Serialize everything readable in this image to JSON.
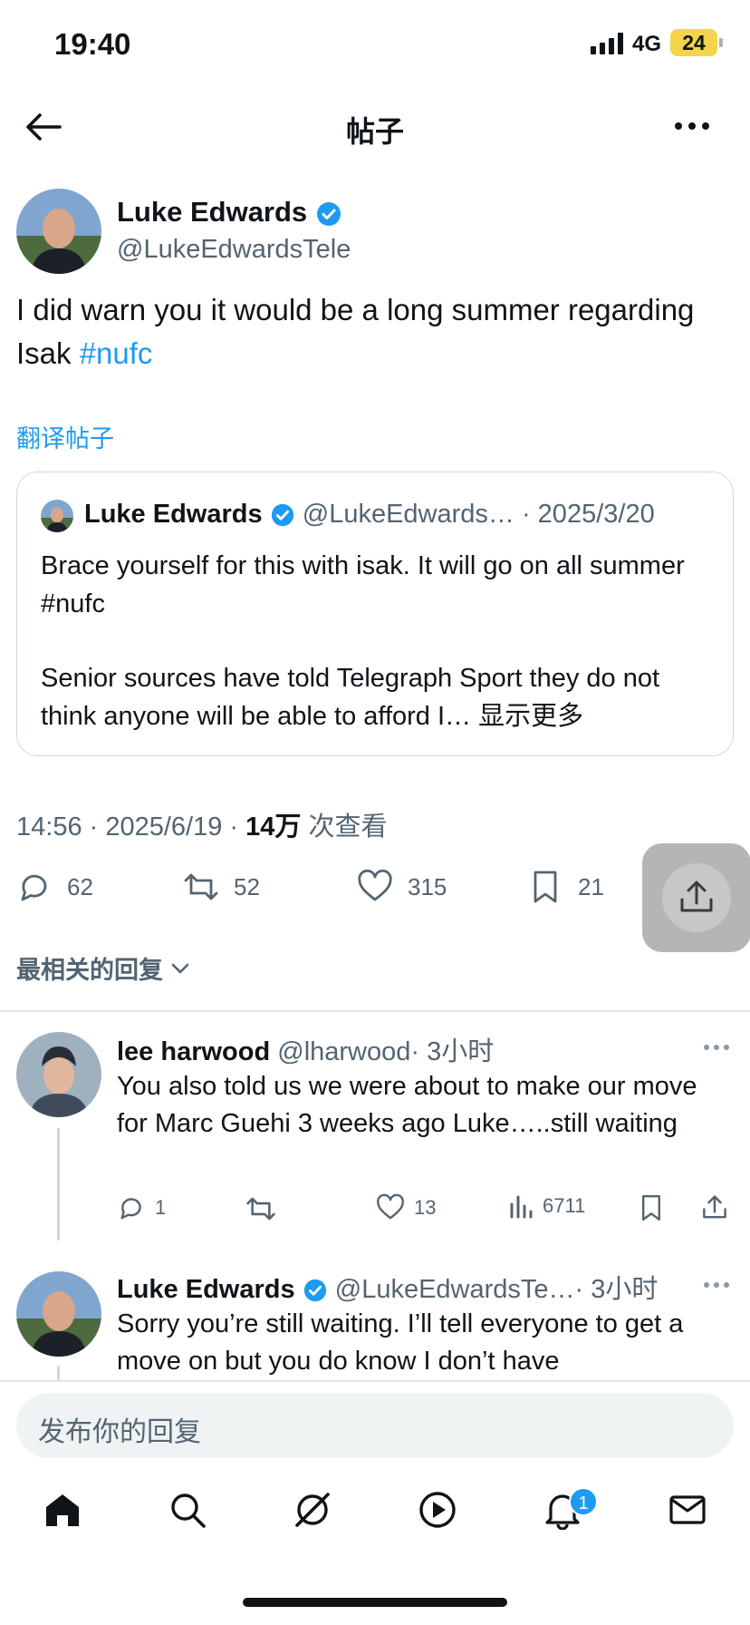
{
  "status_bar": {
    "time": "19:40",
    "network": "4G",
    "battery": "24"
  },
  "header": {
    "title": "帖子"
  },
  "post": {
    "author_name": "Luke Edwards",
    "author_handle": "@LukeEdwardsTele",
    "text_main": "I did warn you it would be a long summer regarding Isak ",
    "hashtag": "#nufc",
    "translate_label": "翻译帖子",
    "quoted": {
      "name": "Luke Edwards",
      "handle": "@LukeEdwards…",
      "date": "· 2025/3/20",
      "text_p1": "Brace yourself for this with isak. It will go on all summer #nufc",
      "text_p2": "Senior sources have told Telegraph Sport they do not think anyone will be able to afford I… 显示更多"
    },
    "meta_time": "14:56 · 2025/6/19 · ",
    "meta_views": "14万",
    "meta_views_label": " 次查看",
    "stats": {
      "replies": "62",
      "reposts": "52",
      "likes": "315",
      "bookmarks": "21"
    }
  },
  "sort_label": "最相关的回复",
  "replies": [
    {
      "name": "lee harwood",
      "handle": "@lharwood",
      "time": "· 3小时",
      "text": "You also told us we were about to make our move for Marc Guehi 3 weeks ago Luke…..still waiting",
      "stats": {
        "replies": "1",
        "likes": "13",
        "views": "6711"
      }
    },
    {
      "name": "Luke Edwards",
      "handle": "@LukeEdwardsTe…",
      "time": "· 3小时",
      "text": "Sorry you’re still waiting. I’ll tell everyone to get a move on but you do know I don’t have"
    }
  ],
  "composer": {
    "placeholder": "发布你的回复"
  },
  "nav": {
    "notification_count": "1"
  },
  "colors": {
    "accent": "#1d9bf0",
    "text": "#0f1419",
    "muted": "#536471",
    "battery": "#f4d44a"
  },
  "icons": [
    "back-arrow-icon",
    "more-icon",
    "verified-icon",
    "reply-icon",
    "repost-icon",
    "like-icon",
    "bookmark-icon",
    "share-icon",
    "chevron-down-icon",
    "views-icon",
    "home-icon",
    "search-icon",
    "grok-icon",
    "video-icon",
    "bell-icon",
    "mail-icon"
  ]
}
